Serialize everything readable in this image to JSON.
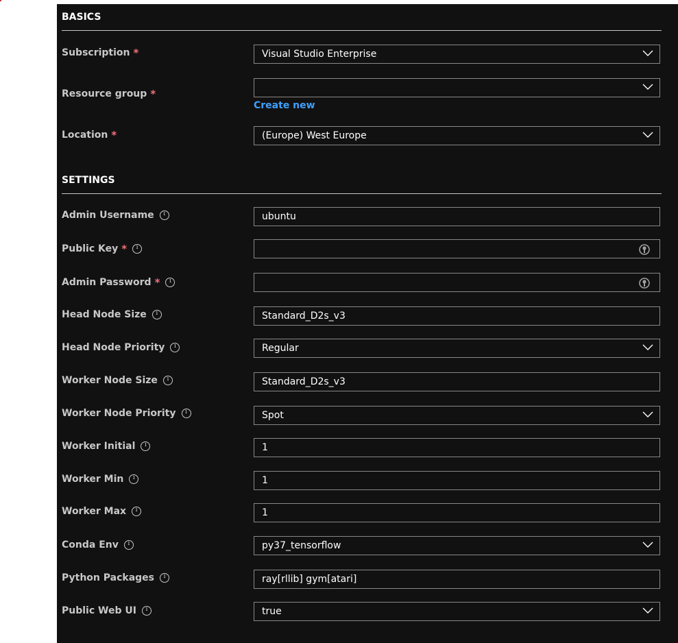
{
  "basics": {
    "title": "BASICS",
    "subscription": {
      "label": "Subscription",
      "value": "Visual Studio Enterprise"
    },
    "resource_group": {
      "label": "Resource group",
      "value": "",
      "create_new": "Create new"
    },
    "location": {
      "label": "Location",
      "value": "(Europe) West Europe"
    }
  },
  "settings": {
    "title": "SETTINGS",
    "admin_username": {
      "label": "Admin Username",
      "value": "ubuntu"
    },
    "public_key": {
      "label": "Public Key",
      "value": ""
    },
    "admin_password": {
      "label": "Admin Password",
      "value": ""
    },
    "head_node_size": {
      "label": "Head Node Size",
      "value": "Standard_D2s_v3"
    },
    "head_node_priority": {
      "label": "Head Node Priority",
      "value": "Regular"
    },
    "worker_node_size": {
      "label": "Worker Node Size",
      "value": "Standard_D2s_v3"
    },
    "worker_node_priority": {
      "label": "Worker Node Priority",
      "value": "Spot"
    },
    "worker_initial": {
      "label": "Worker Initial",
      "value": "1"
    },
    "worker_min": {
      "label": "Worker Min",
      "value": "1"
    },
    "worker_max": {
      "label": "Worker Max",
      "value": "1"
    },
    "conda_env": {
      "label": "Conda Env",
      "value": "py37_tensorflow"
    },
    "python_packages": {
      "label": "Python Packages",
      "value": "ray[rllib] gym[atari]"
    },
    "public_web_ui": {
      "label": "Public Web UI",
      "value": "true"
    }
  },
  "required_marker": "*",
  "colors": {
    "background": "#111111",
    "accent_link": "#3fa0ff",
    "required": "#f1707b"
  }
}
